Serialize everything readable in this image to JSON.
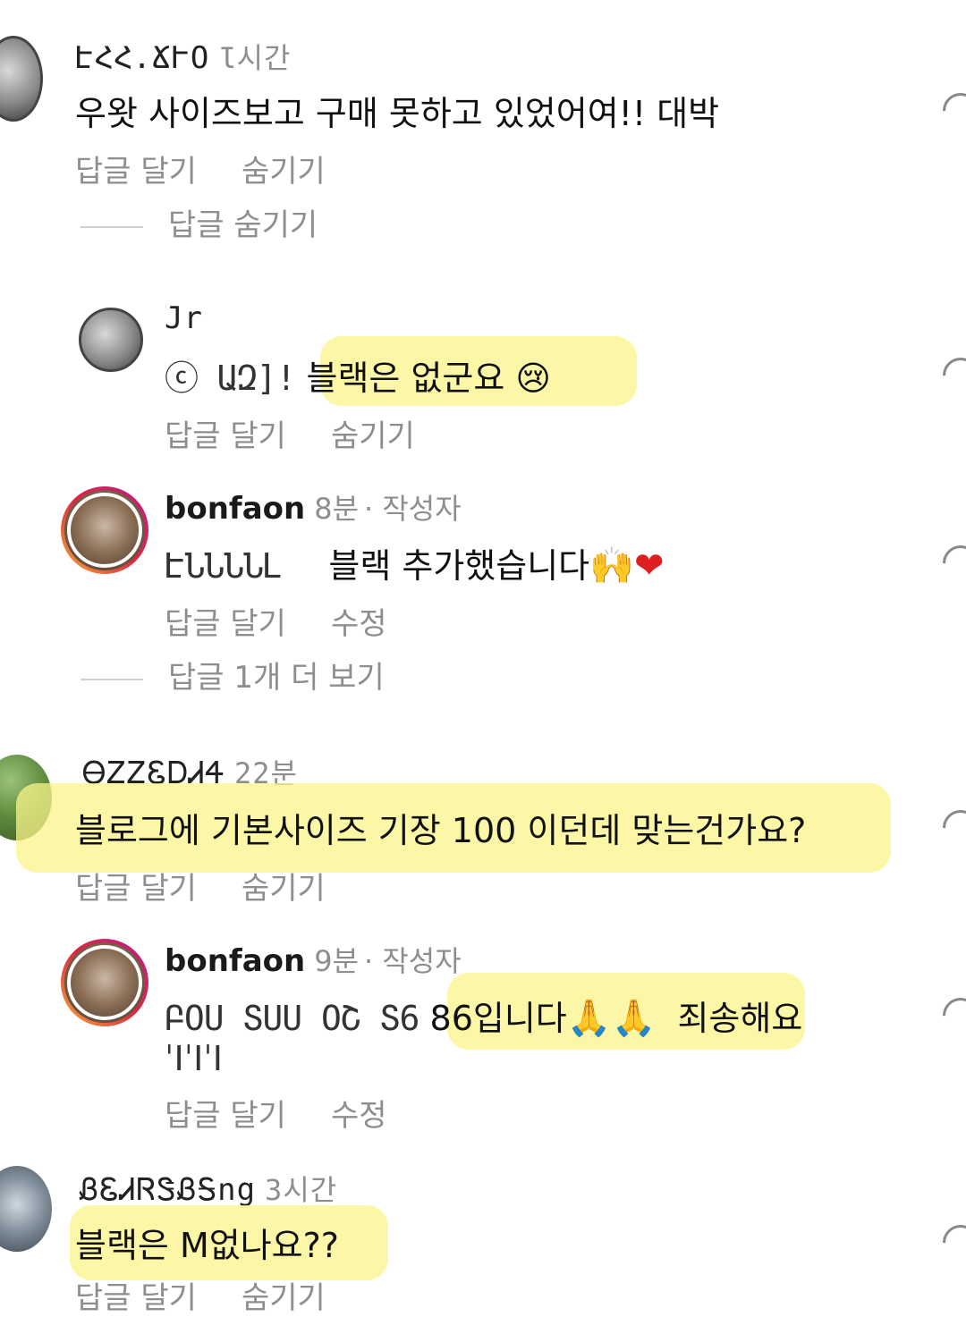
{
  "comments": [
    {
      "username": "ԷՀՀ.ՃՒՕ",
      "time": "Ɩ시간",
      "text": "우왓 사이즈보고 구매 못하고 있었어여!! 대박",
      "actions": [
        "답글 달기",
        "숨기기"
      ],
      "view_replies": "답글 숨기기"
    },
    {
      "username": "Jr",
      "mention": "ⓒ ԱԶ]!",
      "text": "블랙은 없군요 😢",
      "actions": [
        "답글 달기",
        "숨기기"
      ]
    },
    {
      "username": "bonfaon",
      "time": "8분",
      "author_tag": "· 작성자",
      "mention": "ԷՆՆՆՆԼ",
      "text": "블랙 추가했습니다",
      "emoji_1": "🙌",
      "emoji_2": "❤",
      "actions": [
        "답글 달기",
        "수정"
      ],
      "view_replies": "답글 1개 더 보기"
    },
    {
      "username": "ᎾᏃᏃᏋᎠᏗᏎ",
      "time": "22분",
      "text": "블로그에 기본사이즈 기장 100 이던데  맞는건가요?",
      "actions": [
        "답글 달기",
        "숨기기"
      ]
    },
    {
      "username": "bonfaon",
      "time": "9분",
      "author_tag": "· 작성자",
      "mention": "ԲՕՍ ՏՍՍ ՕՇ Տ6",
      "text": "86입니다",
      "emoji": "🙏🙏",
      "text_tail": "죄송해요",
      "text_line2": "ˈIˈIˈI",
      "actions": [
        "답글 달기",
        "수정"
      ]
    },
    {
      "username": "ᏰᏋᏗᏒᏕᏰᎦng",
      "time": "3시간",
      "text": "블랙은 M없나요??",
      "actions": [
        "답글 달기",
        "숨기기"
      ]
    }
  ],
  "colors": {
    "highlight": "#fbf48a",
    "secondary_text": "#8e8e8e",
    "story_ring": "#dc2743"
  }
}
